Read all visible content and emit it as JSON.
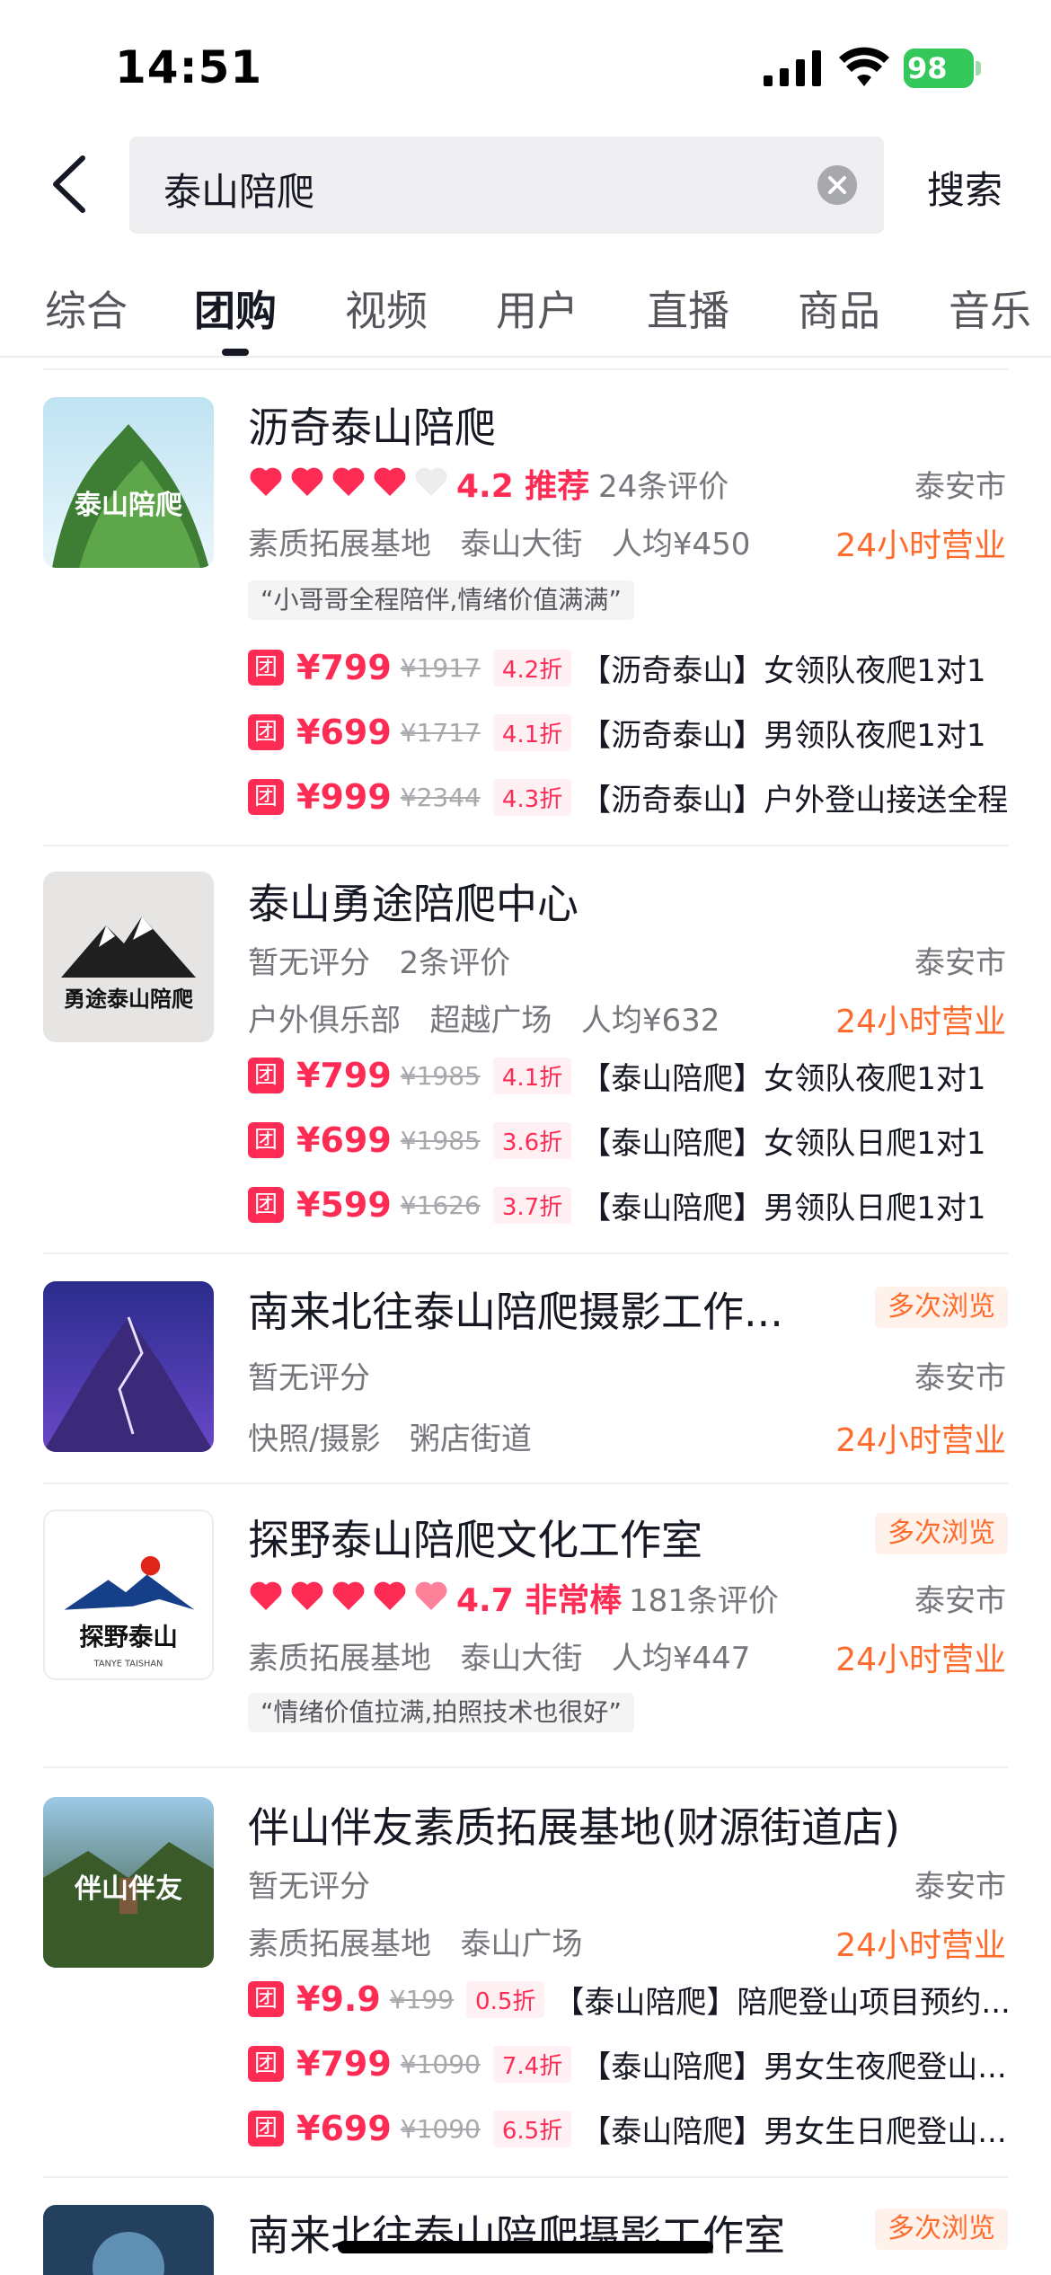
{
  "status_bar": {
    "time": "14:51",
    "battery": "98"
  },
  "search": {
    "query": "泰山陪爬",
    "button": "搜索"
  },
  "tabs": [
    "综合",
    "团购",
    "视频",
    "用户",
    "直播",
    "商品",
    "音乐"
  ],
  "active_tab": "团购",
  "results": [
    {
      "name": "沥奇泰山陪爬",
      "rating": "4.2 推荐",
      "reviews": "24条评价",
      "city": "泰安市",
      "category": "素质拓展基地",
      "area": "泰山大街",
      "avg_price": "人均¥450",
      "hours": "24小时营业",
      "quote": "“小哥哥全程陪伴,情绪价值满满”",
      "thumb_text": "泰山陪爬",
      "deals": [
        {
          "tag": "团",
          "price": "¥799",
          "orig": "¥1917",
          "discount": "4.2折",
          "name": "【沥奇泰山】女领队夜爬1对1"
        },
        {
          "tag": "团",
          "price": "¥699",
          "orig": "¥1717",
          "discount": "4.1折",
          "name": "【沥奇泰山】男领队夜爬1对1"
        },
        {
          "tag": "团",
          "price": "¥999",
          "orig": "¥2344",
          "discount": "4.3折",
          "name": "【沥奇泰山】户外登山接送全程"
        }
      ]
    },
    {
      "name": "泰山勇途陪爬中心",
      "rating": "暂无评分",
      "reviews": "2条评价",
      "city": "泰安市",
      "category": "户外俱乐部",
      "area": "超越广场",
      "avg_price": "人均¥632",
      "hours": "24小时营业",
      "thumb_text": "勇途泰山陪爬",
      "deals": [
        {
          "tag": "团",
          "price": "¥799",
          "orig": "¥1985",
          "discount": "4.1折",
          "name": "【泰山陪爬】女领队夜爬1对1"
        },
        {
          "tag": "团",
          "price": "¥699",
          "orig": "¥1985",
          "discount": "3.6折",
          "name": "【泰山陪爬】女领队日爬1对1"
        },
        {
          "tag": "团",
          "price": "¥599",
          "orig": "¥1626",
          "discount": "3.7折",
          "name": "【泰山陪爬】男领队日爬1对1"
        }
      ]
    },
    {
      "name": "南来北往泰山陪爬摄影工作...",
      "badge": "多次浏览",
      "rating": "暂无评分",
      "city": "泰安市",
      "category": "快照/摄影",
      "area": "粥店街道",
      "hours": "24小时营业"
    },
    {
      "name": "探野泰山陪爬文化工作室",
      "badge": "多次浏览",
      "rating": "4.7 非常棒",
      "reviews": "181条评价",
      "city": "泰安市",
      "category": "素质拓展基地",
      "area": "泰山大街",
      "avg_price": "人均¥447",
      "hours": "24小时营业",
      "quote": "“情绪价值拉满,拍照技术也很好”",
      "thumb_text": "探野泰山",
      "thumb_sub": "TANYE TAISHAN"
    },
    {
      "name": "伴山伴友素质拓展基地(财源街道店)",
      "rating": "暂无评分",
      "city": "泰安市",
      "category": "素质拓展基地",
      "area": "泰山广场",
      "hours": "24小时营业",
      "thumb_text": "伴山伴友",
      "deals": [
        {
          "tag": "团",
          "price": "¥9.9",
          "orig": "¥199",
          "discount": "0.5折",
          "name": "【泰山陪爬】陪爬登山项目预约..."
        },
        {
          "tag": "团",
          "price": "¥799",
          "orig": "¥1090",
          "discount": "7.4折",
          "name": "【泰山陪爬】男女生夜爬登山..."
        },
        {
          "tag": "团",
          "price": "¥699",
          "orig": "¥1090",
          "discount": "6.5折",
          "name": "【泰山陪爬】男女生日爬登山..."
        }
      ]
    },
    {
      "name": "南来北往泰山陪爬摄影工作室",
      "badge": "多次浏览"
    }
  ],
  "colors": {
    "accent_red": "#fe2c55",
    "accent_orange": "#fe6b2c",
    "battery_green": "#34c759"
  }
}
